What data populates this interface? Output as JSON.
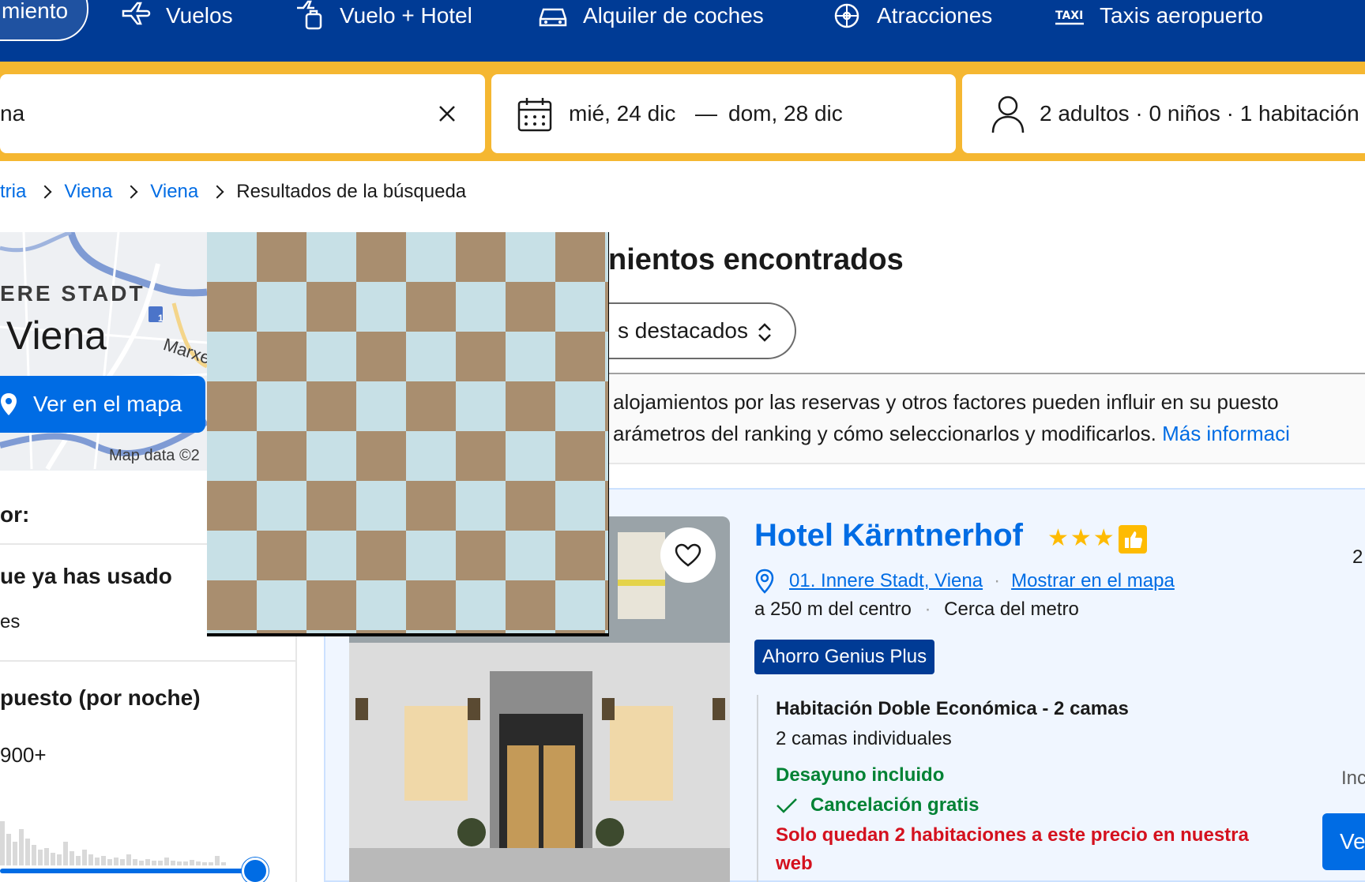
{
  "nav": {
    "active_label": "miento",
    "items": [
      {
        "label": "Vuelos",
        "icon": "plane-icon"
      },
      {
        "label": "Vuelo + Hotel",
        "icon": "flight-hotel-icon"
      },
      {
        "label": "Alquiler de coches",
        "icon": "car-icon"
      },
      {
        "label": "Atracciones",
        "icon": "attractions-icon"
      },
      {
        "label": "Taxis aeropuerto",
        "icon": "taxi-icon"
      }
    ]
  },
  "search": {
    "destination": "na",
    "dates_start": "mié, 24 dic",
    "dates_sep": "—",
    "dates_end": "dom, 28 dic",
    "guests": "2 adultos · 0 niños · 1 habitación"
  },
  "breadcrumb": {
    "items": [
      "tria",
      "Viena",
      "Viena"
    ],
    "current": "Resultados de la búsqueda"
  },
  "map": {
    "district_label": "ERE STADT",
    "city_label": "Viena",
    "street_label": "Marxe",
    "attribution": "Map data ©2",
    "cta_label": "Ver en el mapa",
    "marker_label": "1"
  },
  "filters": {
    "title": "or:",
    "used_title": "ue ya has usado",
    "used_sub": "es",
    "budget_title": "puesto (por noche)",
    "budget_max": "900+"
  },
  "results": {
    "title": "nientos encontrados",
    "sort_label": "s destacados",
    "notice_line1": "alojamientos por las reservas y otros factores pueden influir en su puesto",
    "notice_line2": "arámetros del ranking y cómo seleccionarlos y modificarlos.",
    "notice_link": "Más informaci"
  },
  "hotel": {
    "name": "Hotel Kärntnerhof",
    "stars": "★★★",
    "district_link": "01. Innere Stadt, Viena",
    "map_link": "Mostrar en el mapa",
    "distance": "a 250 m del centro",
    "metro": "Cerca del metro",
    "badge": "Ahorro Genius Plus",
    "room_title": "Habitación Doble Económica - 2 camas",
    "room_beds": "2 camas individuales",
    "breakfast": "Desayuno incluido",
    "cancellation": "Cancelación gratis",
    "scarcity": "Solo quedan 2 habitaciones a este precio en nuestra web",
    "right_peek": "2",
    "includes_peek": "Inc",
    "cta": "Ve"
  },
  "colors": {
    "brand_blue": "#003b95",
    "accent_yellow": "#f5b731",
    "link_blue": "#006ce4",
    "green": "#008234",
    "red": "#d4111e"
  }
}
